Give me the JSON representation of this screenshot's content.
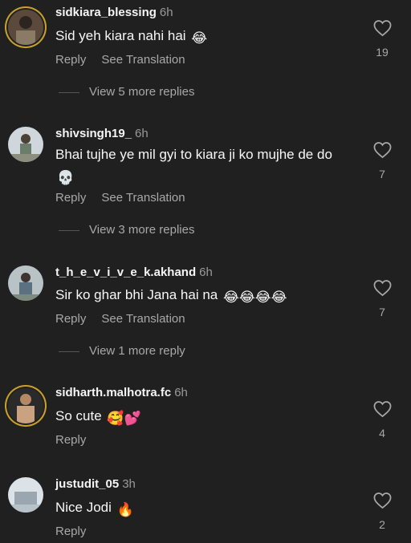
{
  "comments": [
    {
      "username": "sidkiara_blessing",
      "time": "6h",
      "text": "Sid yeh kiara nahi hai",
      "emojis": "😂",
      "reply_label": "Reply",
      "translate_label": "See Translation",
      "likes": "19",
      "more_replies": "View 5 more replies"
    },
    {
      "username": "shivsingh19_",
      "time": "6h",
      "text": "Bhai tujhe ye mil gyi to kiara ji ko mujhe de do",
      "emojis": "💀",
      "reply_label": "Reply",
      "translate_label": "See Translation",
      "likes": "7",
      "more_replies": "View 3 more replies"
    },
    {
      "username": "t_h_e_v_i_v_e_k.akhand",
      "time": "6h",
      "text": "Sir ko ghar bhi Jana hai na",
      "emojis": "😂😂😂😂",
      "reply_label": "Reply",
      "translate_label": "See Translation",
      "likes": "7",
      "more_replies": "View 1 more reply"
    },
    {
      "username": "sidharth.malhotra.fc",
      "time": "6h",
      "text": "So cute",
      "emojis": "🥰💕",
      "reply_label": "Reply",
      "likes": "4"
    },
    {
      "username": "justudit_05",
      "time": "3h",
      "text": "Nice Jodi",
      "emojis": "🔥",
      "reply_label": "Reply",
      "likes": "2"
    }
  ],
  "icons": {
    "like": "heart-outline-icon",
    "avatar": "user-avatar"
  },
  "colors": {
    "background": "#202020",
    "muted_text": "#a8a8a8",
    "story_ring": "#c9a227"
  }
}
